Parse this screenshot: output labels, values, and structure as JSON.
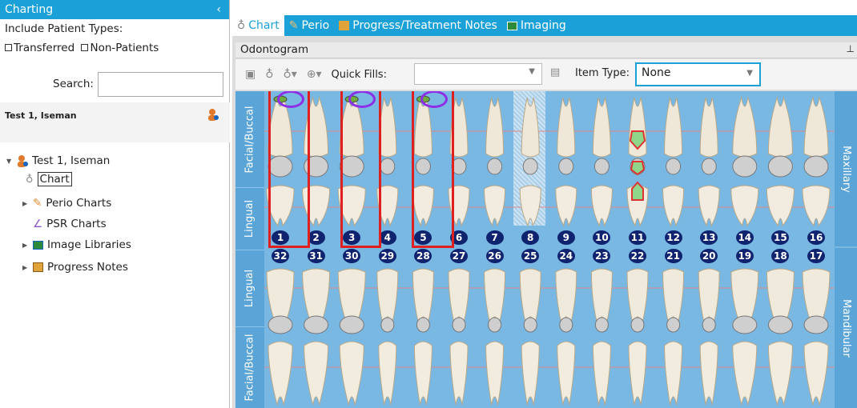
{
  "left": {
    "title": "Charting",
    "collapse": "‹",
    "include_label": "Include Patient Types:",
    "transferred": "Transferred",
    "non_patients": "Non-Patients",
    "search_label": "Search:",
    "patient_name": "Test 1, Iseman",
    "tree": {
      "patient": "Test 1, Iseman",
      "chart": "Chart",
      "perio": "Perio Charts",
      "psr": "PSR Charts",
      "images": "Image Libraries",
      "progress": "Progress Notes"
    }
  },
  "tabs": [
    "Chart",
    "Perio",
    "Progress/Treatment Notes",
    "Imaging"
  ],
  "panel_title": "Odontogram",
  "toolbar": {
    "quick_fills_label": "Quick Fills:",
    "quick_fills_value": "",
    "item_type_label": "Item Type:",
    "item_type_value": "None"
  },
  "side_labels": {
    "facial_top": "Facial/Buccal",
    "lingual_top": "Lingual",
    "lingual_bottom": "Lingual",
    "facial_bottom": "Facial/Buccal",
    "maxillary": "Maxillary",
    "mandibular": "Mandibular"
  },
  "upper_numbers": [
    "1",
    "2",
    "3",
    "4",
    "5",
    "6",
    "7",
    "8",
    "9",
    "10",
    "11",
    "12",
    "13",
    "14",
    "15",
    "16"
  ],
  "lower_numbers": [
    "32",
    "31",
    "30",
    "29",
    "28",
    "27",
    "26",
    "25",
    "24",
    "23",
    "22",
    "21",
    "20",
    "19",
    "18",
    "17"
  ],
  "colors": {
    "accent": "#1ba1d8",
    "chart_bg": "#7ab8e4",
    "highlight_box": "#e0201f",
    "highlight_oval": "#8c2fe6",
    "tooth_number": "#10236e"
  }
}
